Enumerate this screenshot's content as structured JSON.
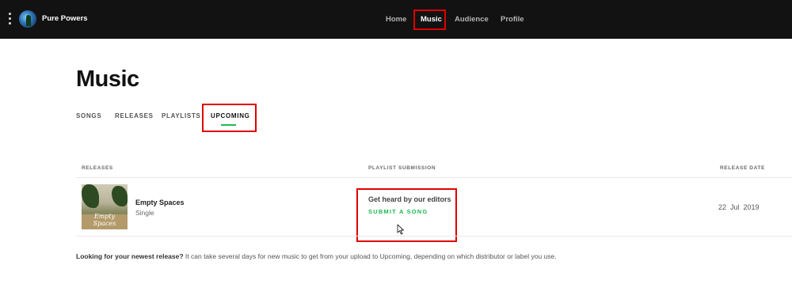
{
  "topbar": {
    "artist_name": "Pure Powers",
    "nav": [
      {
        "label": "Home"
      },
      {
        "label": "Music"
      },
      {
        "label": "Audience"
      },
      {
        "label": "Profile"
      }
    ],
    "active_nav": "Music"
  },
  "page": {
    "title": "Music",
    "tabs": [
      {
        "label": "SONGS"
      },
      {
        "label": "RELEASES"
      },
      {
        "label": "PLAYLISTS"
      },
      {
        "label": "UPCOMING"
      }
    ],
    "active_tab": "UPCOMING"
  },
  "table": {
    "columns": {
      "releases": "RELEASES",
      "playlist_submission": "PLAYLIST SUBMISSION",
      "release_date": "RELEASE DATE"
    },
    "rows": [
      {
        "cover_text": "Empty Spaces",
        "title": "Empty Spaces",
        "type": "Single",
        "pitch_title": "Get heard by our editors",
        "pitch_action": "SUBMIT A SONG",
        "release_date": "22  Jul  2019"
      }
    ]
  },
  "footnote": {
    "bold": "Looking for your newest release?",
    "text": " It can take several days for new music to get from your upload to Upcoming, depending on which distributor or label you use."
  },
  "colors": {
    "topbar_bg": "#121212",
    "accent_green": "#1db954",
    "highlight_red": "#e00000"
  }
}
